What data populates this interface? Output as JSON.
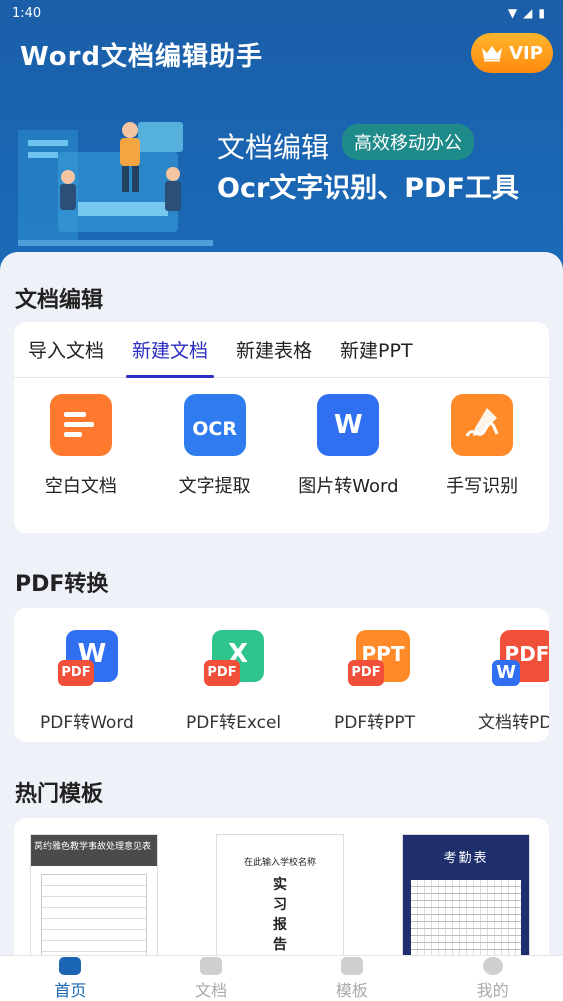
{
  "status": {
    "time": "1:40"
  },
  "header": {
    "title": "Word文档编辑助手",
    "vip_label": "VIP"
  },
  "banner": {
    "line1": "文档编辑",
    "tag": "高效移动办公",
    "line2": "Ocr文字识别、PDF工具"
  },
  "doc_edit": {
    "title": "文档编辑",
    "tabs": [
      "导入文档",
      "新建文档",
      "新建表格",
      "新建PPT"
    ],
    "active_tab": 1,
    "items": [
      {
        "label": "空白文档",
        "icon": "blank-doc-icon",
        "color": "#ff7a2f"
      },
      {
        "label": "文字提取",
        "icon": "ocr-icon",
        "icon_text": "OCR",
        "color": "#2f7bf0"
      },
      {
        "label": "图片转Word",
        "icon": "image-to-word-icon",
        "icon_text": "W",
        "color": "#2f6ff0"
      },
      {
        "label": "手写识别",
        "icon": "handwriting-icon",
        "color": "#ff8a2a"
      }
    ]
  },
  "pdf": {
    "title": "PDF转换",
    "items": [
      {
        "label": "PDF转Word",
        "icon": "pdf-to-word-icon",
        "letter": "W",
        "badge": "PDF",
        "color": "#2f6ff0"
      },
      {
        "label": "PDF转Excel",
        "icon": "pdf-to-excel-icon",
        "letter": "X",
        "badge": "PDF",
        "color": "#2ec48c"
      },
      {
        "label": "PDF转PPT",
        "icon": "pdf-to-ppt-icon",
        "letter": "PPT",
        "badge": "PDF",
        "color": "#ff8a2a"
      },
      {
        "label": "文档转PDF",
        "icon": "doc-to-pdf-icon",
        "letter": "PDF",
        "badge": "W",
        "color": "#f0503a"
      }
    ]
  },
  "templates": {
    "title": "热门模板",
    "items": [
      {
        "title": "莴约雅色教学事故处理意见表"
      },
      {
        "title": "在此输入学校名称",
        "lines": [
          "实",
          "习",
          "报",
          "告"
        ]
      },
      {
        "title": "考勤表"
      }
    ]
  },
  "nav": {
    "items": [
      "首页",
      "文档",
      "模板",
      "我的"
    ],
    "active": 0
  }
}
